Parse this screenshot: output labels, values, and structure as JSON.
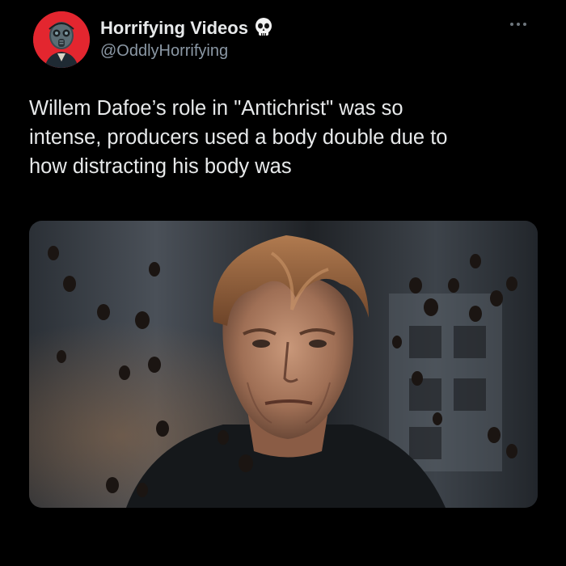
{
  "tweet": {
    "display_name": "Horrifying Videos",
    "handle": "@OddlyHorrifying",
    "badge_icon": "skull-icon",
    "more_icon": "more-horizontal-icon",
    "text": "Willem Dafoe’s role in \"Antichrist\" was so\nintense, producers used a body double due to\nhow distracting his body was",
    "media": {
      "icon": "photo-man-with-floating-acorns"
    }
  },
  "colors": {
    "background": "#000000",
    "text_primary": "#e7e9ea",
    "text_secondary": "#8b98a5",
    "avatar_bg": "#e3262f"
  }
}
